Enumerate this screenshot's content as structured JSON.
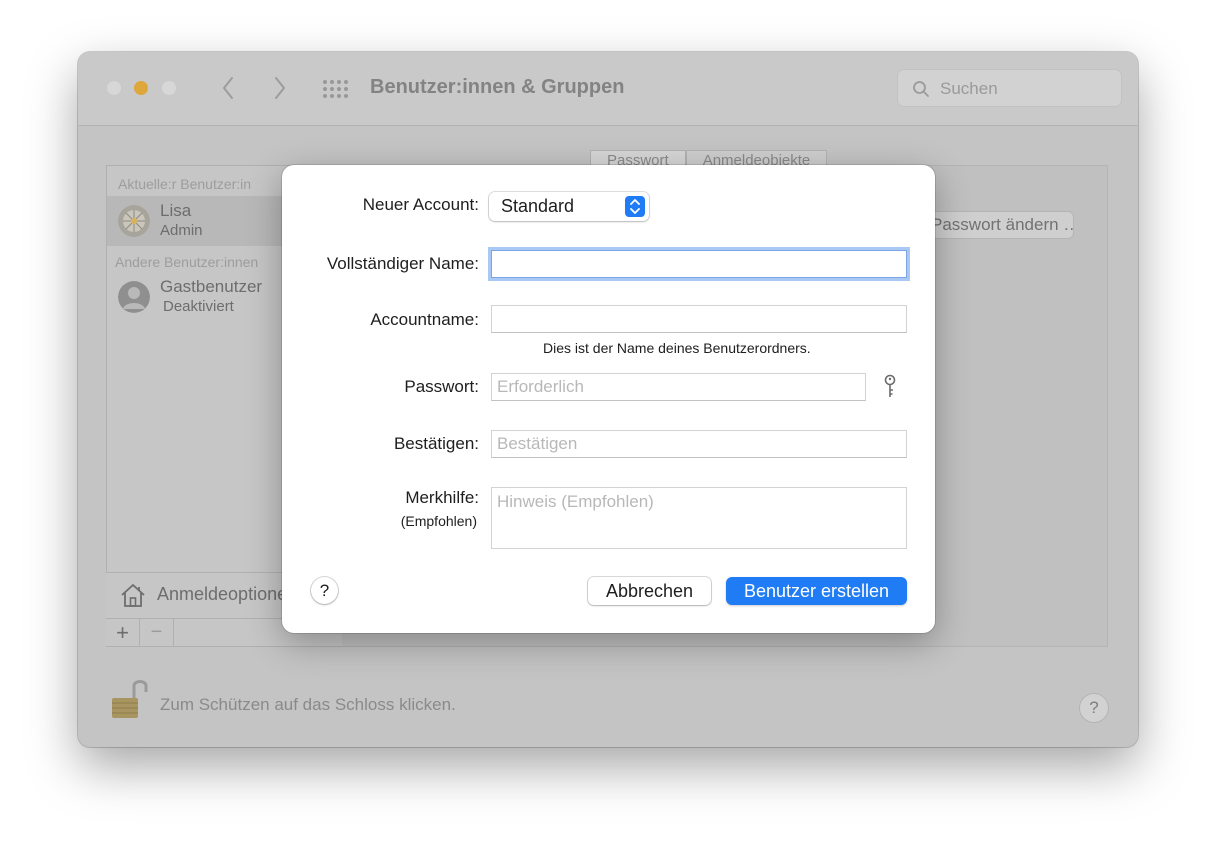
{
  "window": {
    "title": "Benutzer:innen & Gruppen",
    "search_placeholder": "Suchen"
  },
  "sidebar": {
    "current_section": "Aktuelle:r Benutzer:in",
    "other_section": "Andere Benutzer:innen",
    "users": [
      {
        "name": "Lisa",
        "role": "Admin",
        "selected": true
      },
      {
        "name": "Gastbenutzer",
        "role": "Deaktiviert",
        "selected": false
      }
    ],
    "login_options": "Anmeldeoptionen",
    "add_symbol": "+",
    "remove_symbol": "−"
  },
  "panel": {
    "tabs": [
      "Passwort",
      "Anmeldeobjekte"
    ],
    "change_password_button": "Passwort ändern …"
  },
  "footer": {
    "lock_text": "Zum Schützen auf das Schloss klicken.",
    "help": "?"
  },
  "sheet": {
    "account_label": "Neuer Account:",
    "account_type": "Standard",
    "fullname_label": "Vollständiger Name:",
    "fullname_value": "",
    "accountname_label": "Accountname:",
    "accountname_value": "",
    "accountname_hint": "Dies ist der Name deines Benutzerordners.",
    "password_label": "Passwort:",
    "password_placeholder": "Erforderlich",
    "confirm_label": "Bestätigen:",
    "confirm_placeholder": "Bestätigen",
    "hint_label": "Merkhilfe:",
    "hint_sublabel": "(Empfohlen)",
    "hint_placeholder": "Hinweis (Empfohlen)",
    "help": "?",
    "cancel_button": "Abbrechen",
    "create_button": "Benutzer erstellen"
  },
  "colors": {
    "accent": "#1f7cf5",
    "minimize": "#dea73c",
    "focus_ring": "#a9c8f3"
  },
  "icons": [
    "chevron-left-icon",
    "chevron-right-icon",
    "grid-icon",
    "search-icon",
    "house-icon",
    "lock-open-icon",
    "key-icon",
    "popup-arrows-icon"
  ]
}
